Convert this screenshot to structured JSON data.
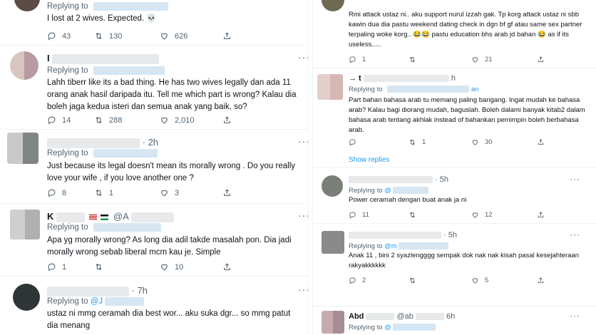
{
  "left_column": {
    "tweets": [
      {
        "replying_label": "Replying to",
        "text": "I lost at 2 wives. Expected. 💀",
        "replies": "43",
        "retweets": "130",
        "likes": "626"
      },
      {
        "author_initial": "I",
        "replying_label": "Replying to",
        "text": "Lahh tiberr like its a bad thing. He has two wives legally dan ada 11 orang anak hasil daripada itu. Tell me which part is wrong? Kalau dia boleh jaga kedua isteri dan semua anak yang baik, so?",
        "replies": "14",
        "retweets": "288",
        "likes": "2,010"
      },
      {
        "time": "· 2h",
        "replying_label": "Replying to",
        "text": "Just because its legal doesn't mean its morally wrong . Do you really love your wife , if you love another one ?",
        "replies": "8",
        "retweets": "1",
        "likes": "3"
      },
      {
        "author_initial": "K",
        "handle_prefix": "@A",
        "replying_label": "Replying to",
        "text": "Apa yg morally wrong? As long dia adil takde masalah pon. Dia jadi morally wrong sebab liberal mcm kau je. Simple",
        "replies": "1",
        "retweets": "",
        "likes": "10"
      },
      {
        "time": "· 7h",
        "replying_label": "Replying to",
        "handle_prefix": "@J",
        "text": "ustaz ni mmg ceramah dia best wor... aku suka dgr... so mmg patut dia menang"
      }
    ]
  },
  "right_column": {
    "show_replies": "Show replies",
    "tweets": [
      {
        "text": "Rmi attack ustaz ni.. aku support nurul izzah gak. Tp korg attack ustaz ni sbb kawin dua dia pastu weekend dating check in dgn bf gf atau same sex partner terpaling woke korg.. 😂😂 pastu education bhs arab jd bahan 😂 as if its useless.....",
        "replies": "1",
        "retweets": "",
        "likes": "21"
      },
      {
        "author_prefix": "→ t",
        "time": "h",
        "replying_label": "Replying to",
        "handle_suffix": "an",
        "text": "Part bahan bahasa arab tu memang paling bangang. Ingat mudah ke bahasa arab? Kalau bagi diorang mudah, baguslah. Boleh dalami banyak kitab2 dalam bahasa arab tentang akhlak instead of bahankan pemimpin boleh berbahasa arab.",
        "replies": "",
        "retweets": "1",
        "likes": "30"
      },
      {
        "time": "· 5h",
        "replying_label": "Replying to",
        "handle_prefix": "@",
        "text": "Power ceramah dengan buat anak ja ni",
        "replies": "11",
        "retweets": "",
        "likes": "12"
      },
      {
        "time": "· 5h",
        "replying_label": "Replying to",
        "handle_prefix": "@m",
        "text": "Anak 11 , bini 2 syazlengggg sempak dok nak nak kisah pasal kesejahteraan rakyakkkkkk",
        "replies": "2",
        "retweets": "",
        "likes": "5"
      },
      {
        "author_prefix": "Abd",
        "handle_prefix": "@ab",
        "time": "6h",
        "replying_label": "Replying to",
        "handle_prefix2": "@"
      }
    ]
  },
  "colors": {
    "text": "#0f1419",
    "muted": "#536471",
    "link": "#1d9bf0",
    "divider": "#eff3f4"
  },
  "icons": [
    "reply-icon",
    "retweet-icon",
    "like-icon",
    "share-icon",
    "more-icon"
  ]
}
